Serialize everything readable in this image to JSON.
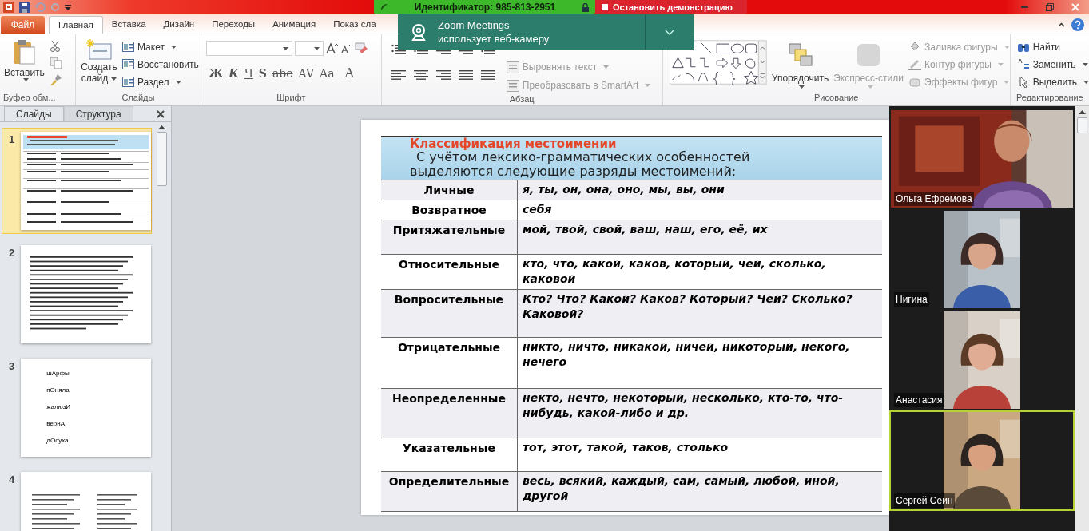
{
  "title_bar": {
    "meeting_id": "Идентификатор: 985-813-2951",
    "stop_share": "Остановить демонстрацию"
  },
  "notification": {
    "title": "Zoom Meetings",
    "message": "использует веб-камеру"
  },
  "tabs": [
    {
      "label": "Файл",
      "kind": "file",
      "selected": false
    },
    {
      "label": "Главная",
      "kind": "tab",
      "selected": true
    },
    {
      "label": "Вставка",
      "kind": "tab",
      "selected": false
    },
    {
      "label": "Дизайн",
      "kind": "tab",
      "selected": false
    },
    {
      "label": "Переходы",
      "kind": "tab",
      "selected": false
    },
    {
      "label": "Анимация",
      "kind": "tab",
      "selected": false
    },
    {
      "label": "Показ сла",
      "kind": "tab",
      "selected": false
    }
  ],
  "ribbon": {
    "clipboard": {
      "label": "Буфер обм...",
      "paste": "Вставить"
    },
    "slides": {
      "label": "Слайды",
      "new_slide": "Создать слайд",
      "items": [
        "Макет",
        "Восстановить",
        "Раздел"
      ]
    },
    "font": {
      "label": "Шрифт",
      "buttons": [
        "Ж",
        "К",
        "Ч",
        "S",
        "abe",
        "AV",
        "Aa",
        "A"
      ]
    },
    "paragraph": {
      "label": "Абзац",
      "items": [
        {
          "label": "Выровнять текст",
          "disabled": true
        },
        {
          "label": "Преобразовать в SmartArt",
          "disabled": true
        }
      ]
    },
    "drawing": {
      "label": "Рисование",
      "arrange": {
        "label": "Упорядочить",
        "disabled": false
      },
      "quick_styles": {
        "label": "Экспресс-стили",
        "disabled": true
      },
      "items": [
        {
          "label": "Заливка фигуры",
          "disabled": true
        },
        {
          "label": "Контур фигуры",
          "disabled": true
        },
        {
          "label": "Эффекты фигур",
          "disabled": true
        }
      ]
    },
    "editing": {
      "label": "Редактирование",
      "items": [
        "Найти",
        "Заменить",
        "Выделить"
      ]
    }
  },
  "panel_tabs": [
    {
      "label": "Слайды",
      "selected": true
    },
    {
      "label": "Структура",
      "selected": false
    }
  ],
  "thumbnails": [
    {
      "number": "1",
      "kind": "table",
      "selected": true
    },
    {
      "number": "2",
      "kind": "text",
      "selected": false
    },
    {
      "number": "3",
      "kind": "words",
      "selected": false,
      "lines": [
        "шАрфы",
        "пОняла",
        "жалюзИ",
        "вернА",
        "дОсуха"
      ]
    },
    {
      "number": "4",
      "kind": "columns",
      "selected": false
    }
  ],
  "slide": {
    "title": "Классификация местоимении",
    "subtitle": "С учётом лексико-грамматических особенностей выделяются следующие разряды местоимений:",
    "rows": [
      {
        "category": "Личные",
        "examples": "я, ты, он, она, оно, мы, вы, они"
      },
      {
        "category": "Возвратное",
        "examples": "себя"
      },
      {
        "category": "Притяжательные",
        "examples": "мой, твой, свой, ваш, наш, его, её, их"
      },
      {
        "category": "Относительные",
        "examples": "кто, что, какой, каков, который, чей, сколько, каковой"
      },
      {
        "category": "Вопросительные",
        "examples": "Кто? Что? Какой? Каков? Который? Чей? Сколько? Каковой?"
      },
      {
        "category": "Отрицательные",
        "examples": "никто, ничто, никакой, ничей, никоторый, некого, нечего"
      },
      {
        "category": "Неопределенные",
        "examples": "некто, нечто, некоторый, несколько, кто-то, что-нибудь, какой-либо и др."
      },
      {
        "category": "Указательные",
        "examples": "тот, этот, такой, таков, столько"
      },
      {
        "category": "Определительные",
        "examples": "весь, всякий, каждый, сам, самый, любой, иной, другой"
      }
    ]
  },
  "participants": [
    {
      "name": "Ольга Ефремова",
      "kind": "wide",
      "speaking": false
    },
    {
      "name": "Нигина",
      "kind": "portrait",
      "speaking": false
    },
    {
      "name": "Анастасия",
      "kind": "portrait",
      "speaking": false
    },
    {
      "name": "Сергей Сеин",
      "kind": "portrait",
      "speaking": true
    }
  ]
}
